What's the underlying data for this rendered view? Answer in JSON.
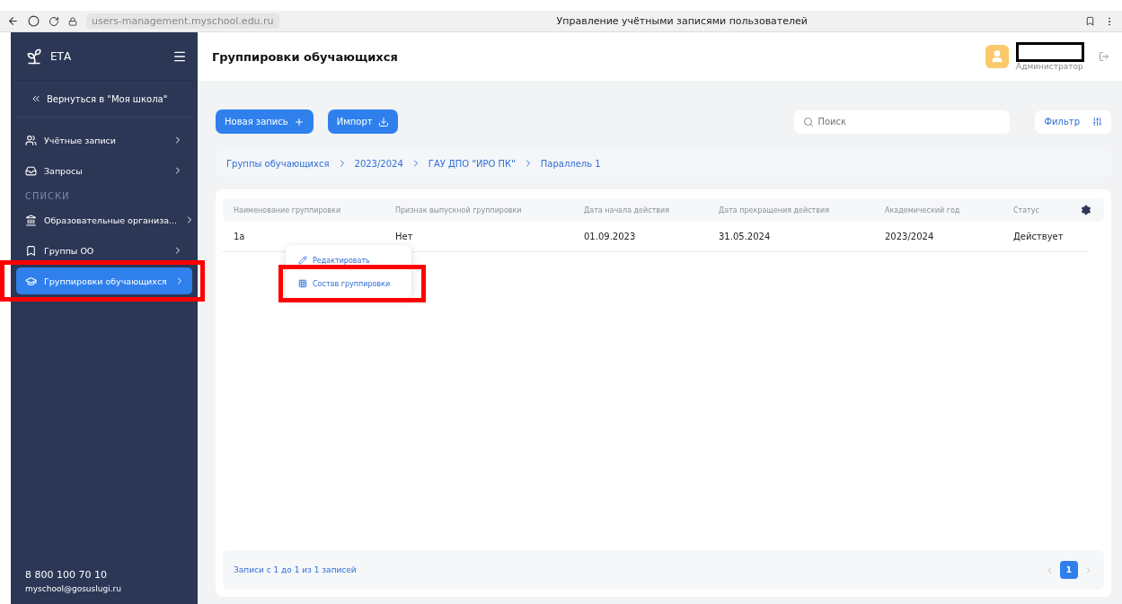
{
  "browser": {
    "url": "users-management.myschool.edu.ru",
    "tab_title": "Управление учётными записями пользователей"
  },
  "sidebar": {
    "logo": "ЕТА",
    "back_link": "Вернуться в \"Моя школа\"",
    "items": [
      {
        "kind": "nav",
        "label": "Учётные записи",
        "selected": false,
        "highlighted": false
      },
      {
        "kind": "nav",
        "label": "Запросы",
        "selected": false,
        "highlighted": false
      },
      {
        "kind": "section",
        "label": "СПИСКИ"
      },
      {
        "kind": "nav",
        "label": "Образовательные организа...",
        "selected": false,
        "highlighted": false
      },
      {
        "kind": "nav",
        "label": "Группы ОО",
        "selected": false,
        "highlighted": false
      },
      {
        "kind": "nav",
        "label": "Группировки обучающихся",
        "selected": true,
        "highlighted": true
      }
    ],
    "phone": "8 800 100 70 10",
    "email": "myschool@gosuslugi.ru"
  },
  "header": {
    "title": "Группировки обучающихся",
    "user_role": "Администратор"
  },
  "toolbar": {
    "buttons": [
      {
        "label": "Новая запись"
      },
      {
        "label": "Импорт"
      }
    ],
    "search": {
      "placeholder": "Поиск"
    },
    "filter": "Фильтр"
  },
  "breadcrumbs": [
    "Группы обучающихся",
    "2023/2024",
    "ГАУ ДПО \"ИРО ПК\"",
    "Параллель 1"
  ],
  "table": {
    "columns": [
      "Наименование группировки",
      "Признак выпускной группировки",
      "Дата начала действия",
      "Дата прекращения действия",
      "Академический год",
      "Статус"
    ],
    "rows": [
      {
        "cells": [
          "1а",
          "Нет",
          "01.09.2023",
          "31.05.2024",
          "2023/2024",
          "Действует"
        ]
      }
    ]
  },
  "context_menu": {
    "items": [
      {
        "label": "Редактировать",
        "highlighted": false
      },
      {
        "label": "Состав группировки",
        "highlighted": true
      }
    ]
  },
  "pagination": {
    "summary": "Записи с 1 до 1 из 1 записей",
    "pages": [
      {
        "label": "1",
        "selected": true
      }
    ]
  }
}
